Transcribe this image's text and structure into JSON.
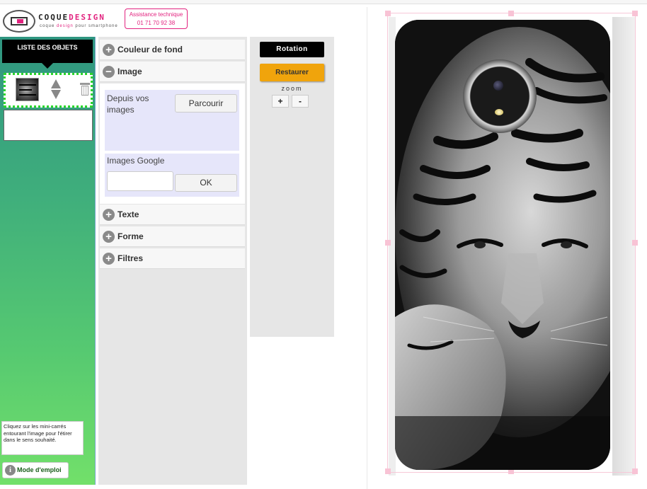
{
  "header": {
    "logo_name_a": "COQUE",
    "logo_name_b": "DESIGN",
    "tagline_a": "coque ",
    "tagline_b": "design",
    "tagline_c": " pour smartphone",
    "assist_label": "Assistance technique",
    "assist_phone": "01 71 70 92 38"
  },
  "sidebar": {
    "list_title": "LISTE DES OBJETS",
    "hint": "Cliquez sur les mini-carrés entourant l'image pour l'étirer dans le sens souhaité.",
    "mode_label": "Mode d'emploi"
  },
  "panel": {
    "sections": {
      "background": "Couleur de fond",
      "image": "Image",
      "text": "Texte",
      "shape": "Forme",
      "filters": "Filtres"
    },
    "image": {
      "local_label": "Depuis vos images",
      "browse_label": "Parcourir",
      "google_label": "Images Google",
      "google_value": "",
      "ok_label": "OK"
    }
  },
  "tools": {
    "rotation_label": "Rotation",
    "restore_label": "Restaurer",
    "zoom_label": "zoom",
    "zoom_in": "+",
    "zoom_out": "-"
  },
  "colors": {
    "accent_pink": "#e2237f",
    "restore_orange": "#f0a40c",
    "sidebar_top": "#2f9580",
    "sidebar_bottom": "#72e06a",
    "selection_green": "#2ad62a"
  }
}
